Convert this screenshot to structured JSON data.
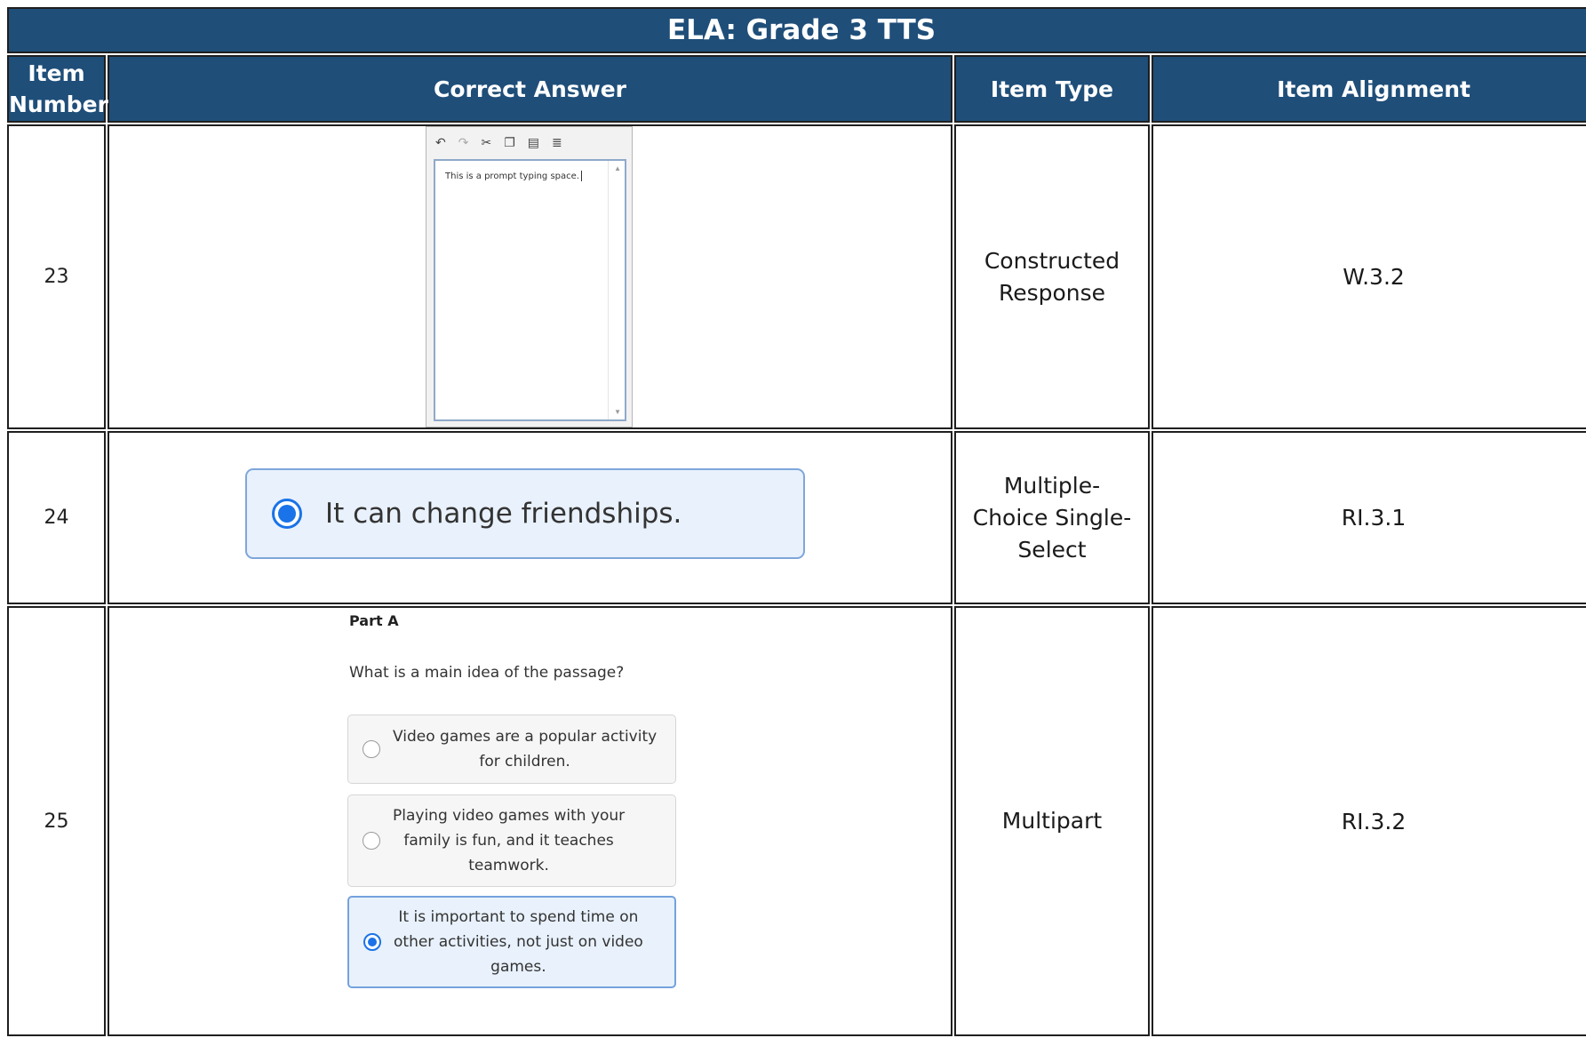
{
  "table": {
    "title": "ELA: Grade 3 TTS",
    "headers": {
      "item_number": "Item Number",
      "correct_answer": "Correct Answer",
      "item_type": "Item Type",
      "item_alignment": "Item Alignment"
    }
  },
  "rows": [
    {
      "number": "23",
      "item_type": "Constructed Response",
      "alignment": "W.3.2",
      "answer": {
        "editor_text": "This is a prompt typing space.",
        "toolbar_icons": [
          "undo-icon",
          "redo-icon",
          "cut-icon",
          "copy-icon",
          "paste-icon",
          "spellcheck-icon"
        ]
      }
    },
    {
      "number": "24",
      "item_type": "Multiple-Choice Single-Select",
      "alignment": "RI.3.1",
      "answer": {
        "choice": "It can change friendships.",
        "selected": true
      }
    },
    {
      "number": "25",
      "item_type": "Multipart",
      "alignment": "RI.3.2",
      "answer": {
        "part_label": "Part A",
        "question": "What is a main idea of the passage?",
        "options": [
          {
            "line1": "Video games are a popular activity",
            "line2": "for children.",
            "line3": "",
            "selected": false
          },
          {
            "line1": "Playing video games with your",
            "line2": "family is fun, and it teaches",
            "line3": "teamwork.",
            "selected": false
          },
          {
            "line1": "It is important to spend time on",
            "line2": "other activities, not just on video",
            "line3": "games.",
            "selected": true
          }
        ]
      }
    }
  ],
  "colors": {
    "header_bg": "#1f4e79",
    "selected_blue": "#1a73e8",
    "selected_bg": "#e8f1fc"
  }
}
